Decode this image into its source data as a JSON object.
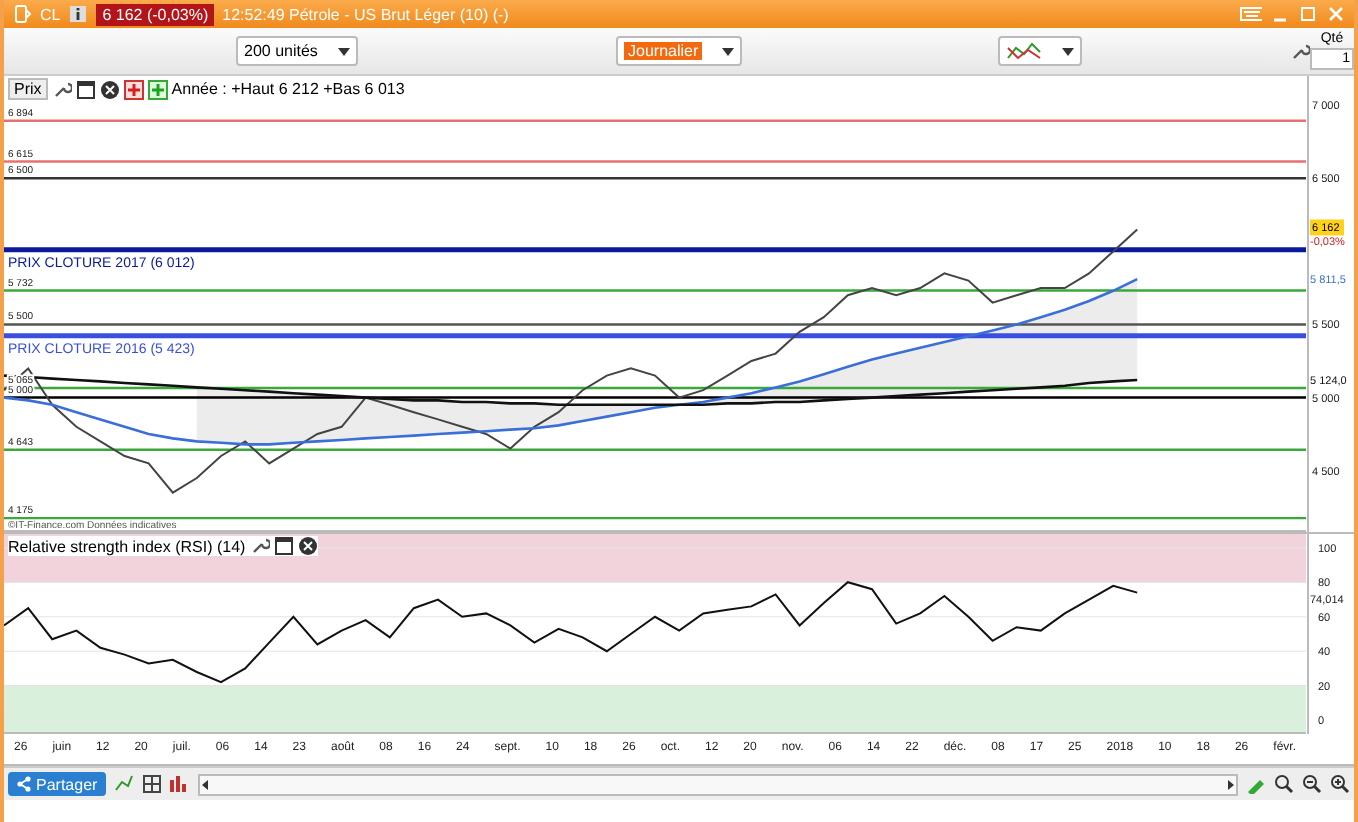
{
  "window": {
    "symbol": "CL",
    "quote": "6 162 (-0,03%)",
    "title": "12:52:49 Pétrole - US Brut Léger (10) (-)"
  },
  "toolbar": {
    "quantity_select": "200 unités",
    "period_select": "Journalier",
    "qty_label": "Qté",
    "qty_value": "1"
  },
  "price_panel": {
    "button": "Prix",
    "summary": "Année : +Haut 6 212 +Bas 6 013",
    "source": "©IT-Finance.com Données indicatives",
    "chart_data": {
      "type": "line",
      "ylim": [
        4080,
        7200
      ],
      "yticks": [
        {
          "value": 7000,
          "label": "7 000"
        },
        {
          "value": 6500,
          "label": "6 500"
        },
        {
          "value": 5500,
          "label": "5 500"
        },
        {
          "value": 5000,
          "label": "5 000"
        },
        {
          "value": 4500,
          "label": "4 500"
        }
      ],
      "series": [
        {
          "color": "#444444",
          "values": [
            5050,
            5200,
            4950,
            4800,
            4700,
            4600,
            4550,
            4350,
            4450,
            4600,
            4700,
            4550,
            4650,
            4750,
            4800,
            5000,
            4950,
            4900,
            4850,
            4800,
            4750,
            4650,
            4800,
            4900,
            5050,
            5150,
            5200,
            5150,
            5000,
            5050,
            5150,
            5250,
            5300,
            5450,
            5550,
            5700,
            5750,
            5700,
            5750,
            5850,
            5800,
            5650,
            5700,
            5750,
            5750,
            5850,
            6000,
            6150,
            null,
            null,
            null,
            null,
            null,
            null,
            null
          ]
        },
        {
          "color": "#3a6fd8",
          "values": [
            5000,
            4980,
            4950,
            4900,
            4850,
            4800,
            4750,
            4720,
            4700,
            4690,
            4680,
            4680,
            4690,
            4700,
            4710,
            4720,
            4730,
            4740,
            4750,
            4760,
            4770,
            4780,
            4790,
            4810,
            4840,
            4870,
            4900,
            4930,
            4950,
            4970,
            5000,
            5030,
            5070,
            5110,
            5160,
            5210,
            5260,
            5300,
            5340,
            5380,
            5420,
            5460,
            5500,
            5550,
            5600,
            5660,
            5730,
            5810,
            null,
            null,
            null,
            null,
            null,
            null,
            null
          ]
        },
        {
          "color": "#111111",
          "values": [
            5150,
            5140,
            5130,
            5120,
            5110,
            5100,
            5090,
            5080,
            5070,
            5060,
            5050,
            5040,
            5030,
            5020,
            5010,
            5000,
            4990,
            4980,
            4980,
            4970,
            4970,
            4960,
            4960,
            4950,
            4950,
            4950,
            4950,
            4950,
            4950,
            4950,
            4960,
            4960,
            4970,
            4970,
            4980,
            4990,
            5000,
            5010,
            5020,
            5030,
            5040,
            5050,
            5060,
            5070,
            5080,
            5100,
            5110,
            5120,
            null,
            null,
            null,
            null,
            null,
            null,
            null
          ]
        }
      ],
      "ref_lines": [
        {
          "axis": "y",
          "value": 6894,
          "label": "6 894",
          "color": "#e87070"
        },
        {
          "axis": "y",
          "value": 6615,
          "label": "6 615",
          "color": "#e87070"
        },
        {
          "axis": "y",
          "value": 6500,
          "label": "6 500",
          "color": "#333333"
        },
        {
          "axis": "y",
          "value": 6012,
          "label": "PRIX CLOTURE 2017 (6 012)",
          "color": "#0a1a9a"
        },
        {
          "axis": "y",
          "value": 5732,
          "label": "5 732",
          "color": "#3aa83a"
        },
        {
          "axis": "y",
          "value": 5500,
          "label": "5 500",
          "color": "#555555"
        },
        {
          "axis": "y",
          "value": 5423,
          "label": "PRIX CLOTURE 2016 (5 423)",
          "color": "#3a4fe0"
        },
        {
          "axis": "y",
          "value": 5065,
          "label": "5 065",
          "color": "#3aa83a"
        },
        {
          "axis": "y",
          "value": 5000,
          "label": "5 000",
          "color": "#000000"
        },
        {
          "axis": "y",
          "value": 4643,
          "label": "4 643",
          "color": "#3aa83a"
        },
        {
          "axis": "y",
          "value": 4175,
          "label": "4 175",
          "color": "#3aa83a"
        }
      ]
    },
    "axis_tags": [
      {
        "kind": "last_price",
        "text": "6 162"
      },
      {
        "kind": "change",
        "text": "-0,03%"
      },
      {
        "kind": "indicator",
        "text": "5 811,5"
      },
      {
        "kind": "indicator",
        "text": "5 124,0"
      }
    ]
  },
  "rsi_panel": {
    "title": "Relative strength index (RSI) (14)",
    "value_tag": "74,014",
    "chart_data": {
      "type": "line",
      "ylim": [
        -8,
        108
      ],
      "yticks": [
        0,
        20,
        40,
        60,
        80,
        100
      ],
      "grid": true,
      "series": [
        {
          "color": "#111111",
          "values": [
            55,
            65,
            47,
            52,
            42,
            38,
            33,
            35,
            28,
            22,
            30,
            45,
            60,
            44,
            52,
            58,
            48,
            65,
            70,
            60,
            62,
            55,
            45,
            53,
            48,
            40,
            50,
            60,
            52,
            62,
            64,
            66,
            73,
            55,
            68,
            80,
            76,
            56,
            62,
            72,
            60,
            46,
            54,
            52,
            62,
            70,
            78,
            74,
            null,
            null,
            null,
            null,
            null,
            null,
            null
          ]
        }
      ],
      "bands": [
        {
          "axis": "y",
          "from": 80,
          "to": 108,
          "color": "#f2d3dc"
        },
        {
          "axis": "y",
          "from": -8,
          "to": 20,
          "color": "#d9f1dc"
        }
      ]
    },
    "date_labels": [
      "26",
      "juin",
      "12",
      "20",
      "juil.",
      "06",
      "14",
      "23",
      "août",
      "08",
      "16",
      "24",
      "sept.",
      "10",
      "18",
      "26",
      "oct.",
      "12",
      "20",
      "nov.",
      "06",
      "14",
      "22",
      "déc.",
      "08",
      "17",
      "25",
      "2018",
      "10",
      "18",
      "26",
      "févr."
    ]
  },
  "bottom_bar": {
    "share_button": "Partager"
  }
}
